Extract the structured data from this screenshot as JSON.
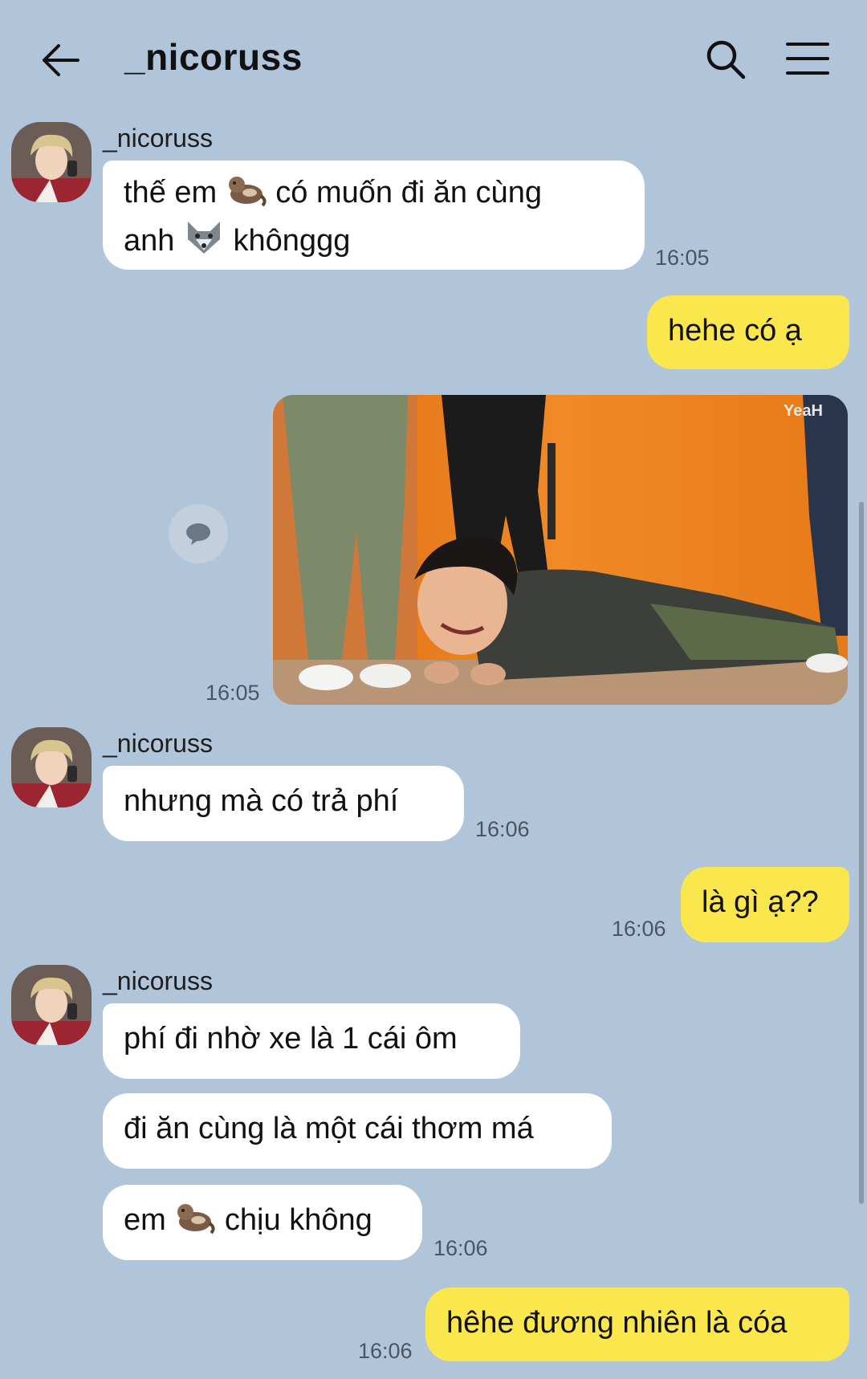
{
  "header": {
    "title": "_nicoruss",
    "back_icon": "back-arrow-icon",
    "search_icon": "search-icon",
    "menu_icon": "hamburger-menu-icon"
  },
  "colors": {
    "background": "#b1c5da",
    "incoming_bubble": "#ffffff",
    "outgoing_bubble": "#fae64d"
  },
  "messages": {
    "m1": {
      "sender": "_nicoruss",
      "line1a": "thế em",
      "line1b": "có muốn đi ăn cùng",
      "line2a": "anh",
      "line2b": "khônggg",
      "time": "16:05"
    },
    "m2": {
      "text": "hehe có ạ"
    },
    "m3": {
      "time": "16:05"
    },
    "m4": {
      "sender": "_nicoruss",
      "text": "nhưng mà có trả phí",
      "time": "16:06"
    },
    "m5": {
      "text": "là gì ạ??",
      "time": "16:06"
    },
    "m6": {
      "sender": "_nicoruss",
      "text1": "phí đi nhờ xe là 1 cái ôm",
      "text2": "đi ăn cùng là một cái thơm má",
      "text3a": "em",
      "text3b": "chịu không",
      "time": "16:06"
    },
    "m7": {
      "text": "hêhe đương nhiên là cóa",
      "time": "16:06"
    }
  },
  "photo_watermark": "YeaH"
}
